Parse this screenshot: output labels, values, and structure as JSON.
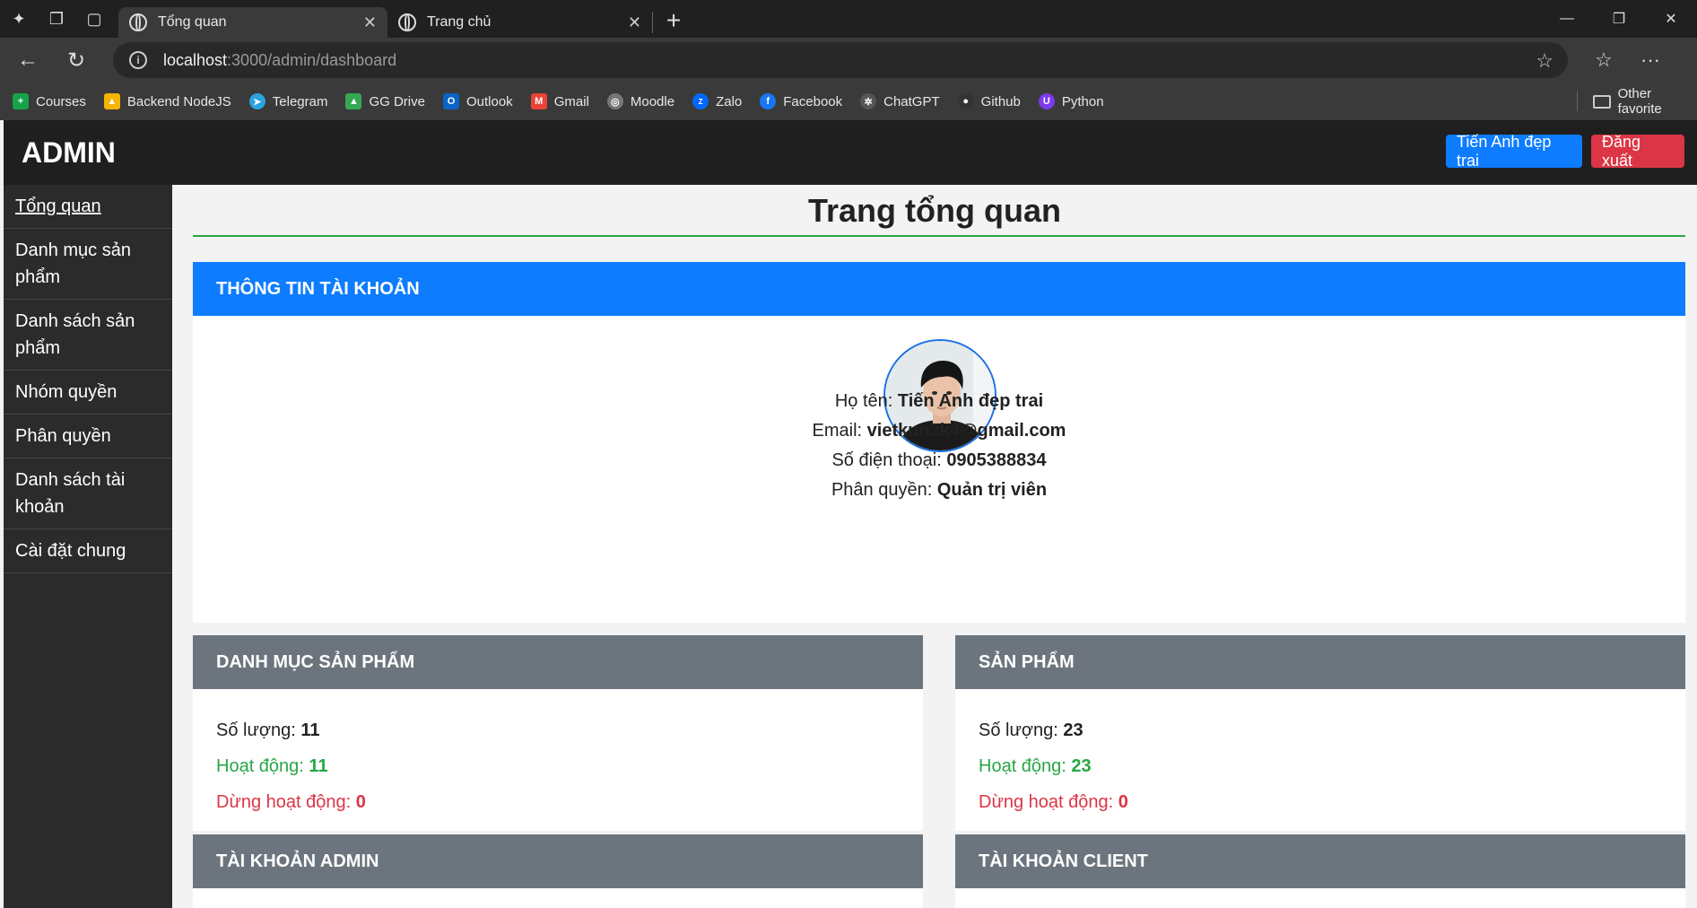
{
  "browser": {
    "tabs": [
      {
        "title": "Tổng quan",
        "active": true
      },
      {
        "title": "Trang chủ",
        "active": false
      }
    ],
    "url_host": "localhost",
    "url_path": ":3000/admin/dashboard",
    "bookmarks": [
      {
        "label": "Courses",
        "icon": "plus-icon",
        "color": "#16a34a"
      },
      {
        "label": "Backend NodeJS",
        "icon": "drive-icon",
        "color": "#f4b400"
      },
      {
        "label": "Telegram",
        "icon": "telegram-icon",
        "color": "#2aa3df"
      },
      {
        "label": "GG Drive",
        "icon": "drive-icon",
        "color": "#34a853"
      },
      {
        "label": "Outlook",
        "icon": "outlook-icon",
        "color": "#0a64c8"
      },
      {
        "label": "Gmail",
        "icon": "gmail-icon",
        "color": "#ea4335"
      },
      {
        "label": "Moodle",
        "icon": "globe-icon",
        "color": "#777777"
      },
      {
        "label": "Zalo",
        "icon": "zalo-icon",
        "color": "#0068ff"
      },
      {
        "label": "Facebook",
        "icon": "facebook-icon",
        "color": "#1877f2"
      },
      {
        "label": "ChatGPT",
        "icon": "chatgpt-icon",
        "color": "#555555"
      },
      {
        "label": "Github",
        "icon": "github-icon",
        "color": "#333333"
      },
      {
        "label": "Python",
        "icon": "python-icon",
        "color": "#7c3aed"
      }
    ],
    "other_favorites": "Other favorite"
  },
  "header": {
    "brand": "ADMIN",
    "user_button": "Tiến Anh đẹp trai",
    "logout_button": "Đăng xuất"
  },
  "sidebar": {
    "items": [
      {
        "label": "Tổng quan",
        "active": true
      },
      {
        "label": "Danh mục sản phẩm"
      },
      {
        "label": "Danh sách sản phẩm"
      },
      {
        "label": "Nhóm quyền"
      },
      {
        "label": "Phân quyền"
      },
      {
        "label": "Danh sách tài khoản"
      },
      {
        "label": "Cài đặt chung"
      }
    ]
  },
  "main": {
    "title": "Trang tổng quan",
    "account": {
      "heading": "THÔNG TIN TÀI KHOẢN",
      "name_label": "Họ tên: ",
      "name": "Tiến Anh đẹp trai",
      "email_label": "Email: ",
      "email": "vietkun2k4@gmail.com",
      "phone_label": "Số điện thoại: ",
      "phone": "0905388834",
      "role_label": "Phân quyền: ",
      "role": "Quản trị viên"
    },
    "categories": {
      "heading": "DANH MỤC SẢN PHẨM",
      "count_label": "Số lượng: ",
      "count": "11",
      "active_label": "Hoạt động: ",
      "active": "11",
      "inactive_label": "Dừng hoạt động: ",
      "inactive": "0"
    },
    "products": {
      "heading": "SẢN PHẨM",
      "count_label": "Số lượng: ",
      "count": "23",
      "active_label": "Hoạt động: ",
      "active": "23",
      "inactive_label": "Dừng hoạt động: ",
      "inactive": "0"
    },
    "admin_accounts": {
      "heading": "TÀI KHOẢN ADMIN"
    },
    "client_accounts": {
      "heading": "TÀI KHOẢN CLIENT"
    }
  },
  "colors": {
    "primary": "#0d7cff",
    "danger": "#dc3545",
    "success": "#28a745",
    "secondary": "#6c757d"
  }
}
